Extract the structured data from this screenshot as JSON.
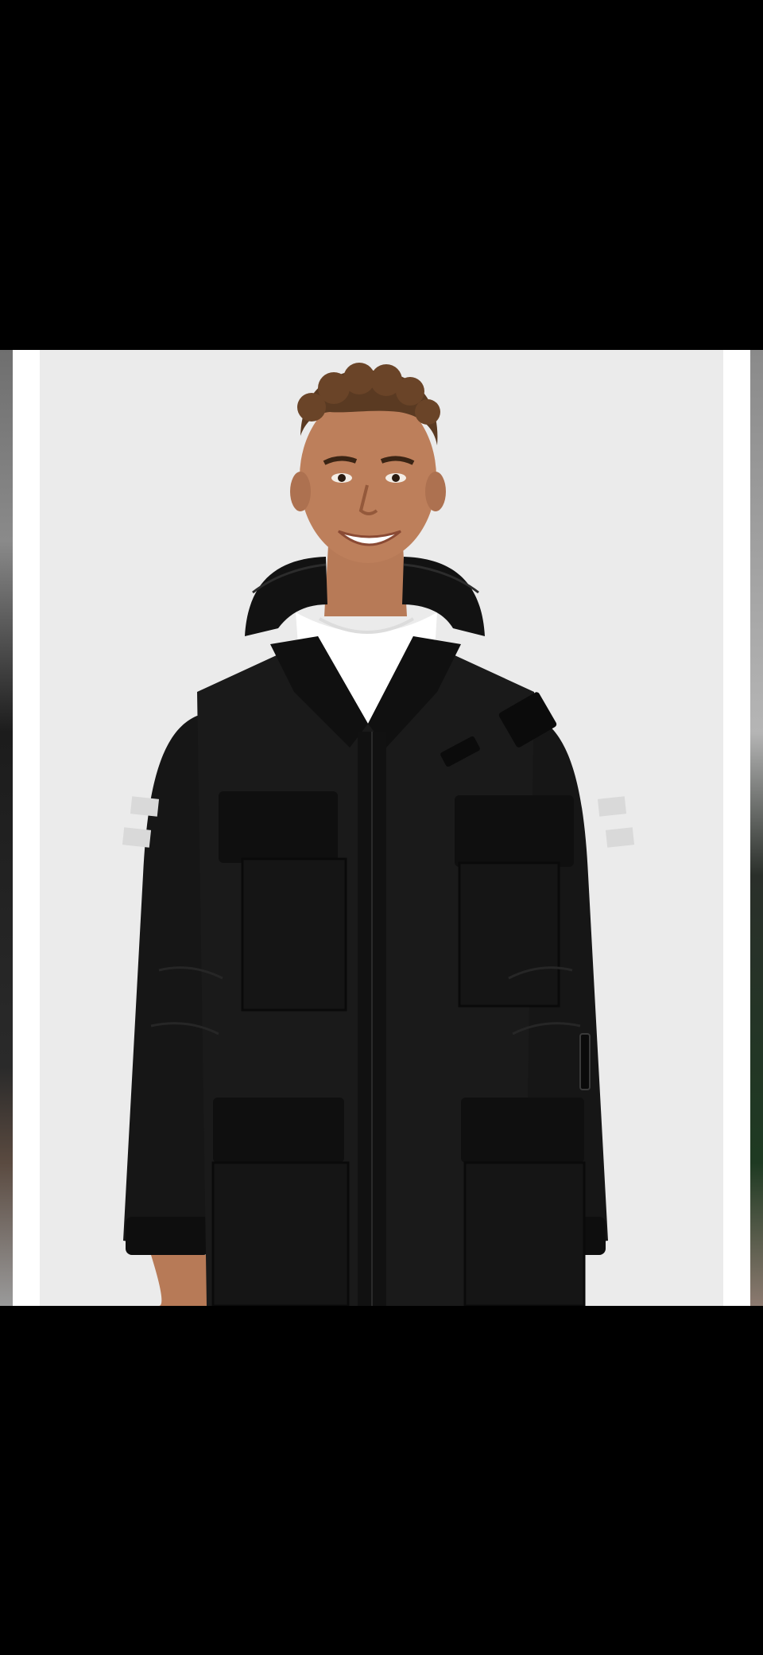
{
  "viewer": {
    "background": "#000000"
  },
  "carousel": {
    "background": "#ffffff",
    "image_background": "#ebebeb",
    "prev_image_peek": "partial-adjacent-product-photo",
    "next_image_peek": "partial-adjacent-product-photo"
  },
  "product_image": {
    "subject": "model-wearing-black-parka",
    "colors": {
      "jacket": "#151515",
      "reflective_stripe": "#d9d9d9",
      "tshirt": "#ffffff",
      "skin": "#b77a57",
      "hair": "#5a3a22"
    }
  }
}
